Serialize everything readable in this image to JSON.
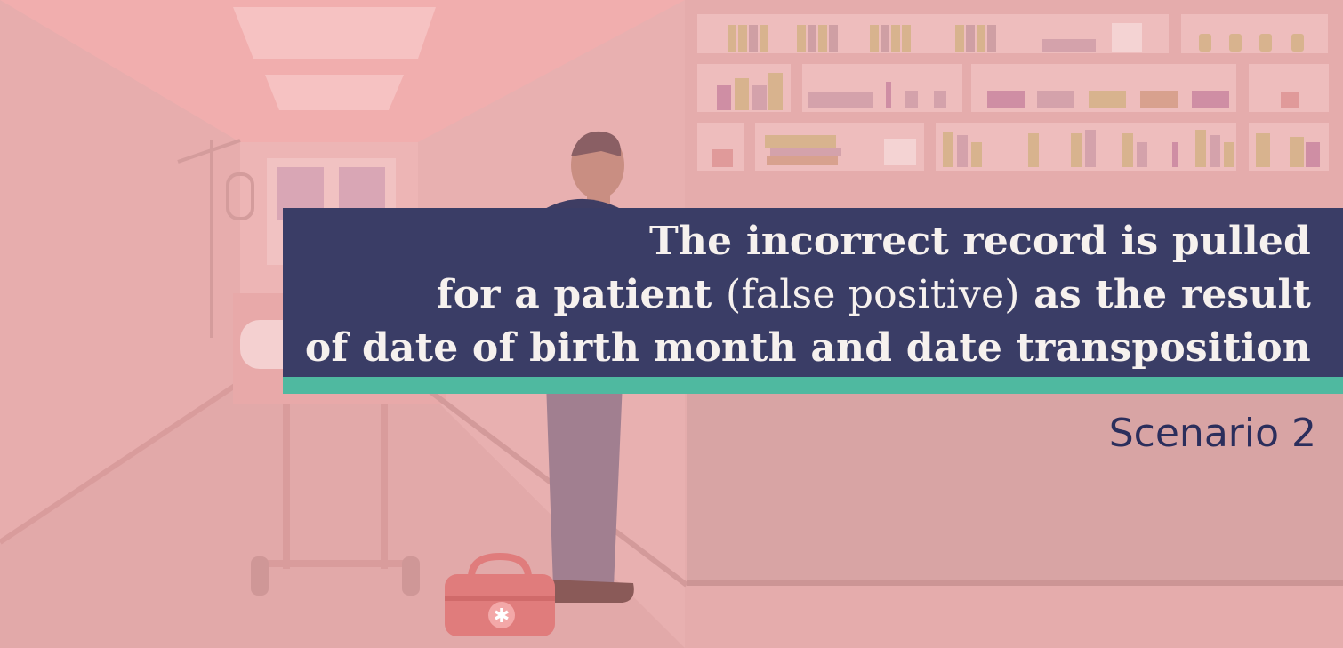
{
  "caption": {
    "line1": "The incorrect record is pulled",
    "line2_part1": "for a patient ",
    "line2_part2": "(false positive)",
    "line2_part3": " as the result",
    "line3": "of date of birth month and date transposition"
  },
  "scenario": {
    "label": "Scenario 2"
  },
  "colors": {
    "background": "#e8b0b0",
    "banner": "#3a3d66",
    "accent": "#4fb9a0",
    "caption_text": "#f6f1ee",
    "scenario_text": "#2b2e5c"
  },
  "icons": {
    "bag_symbol": "medical-bag-icon"
  }
}
